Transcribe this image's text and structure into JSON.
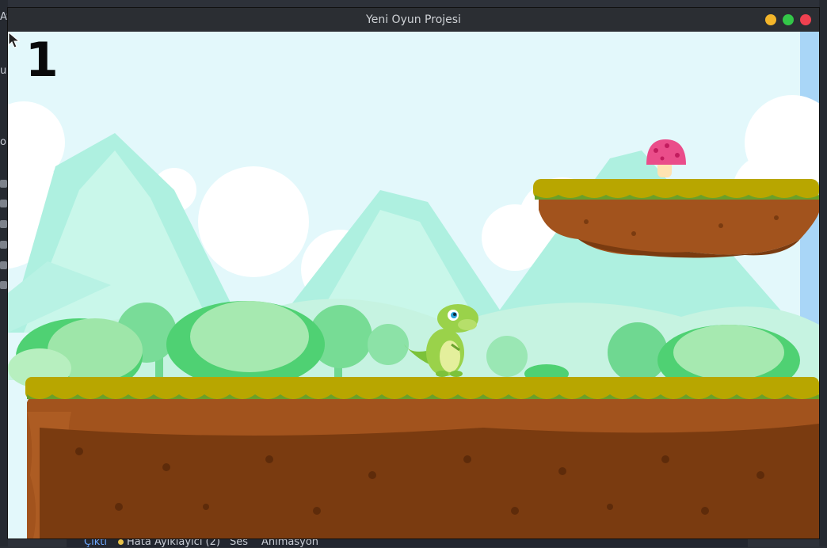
{
  "window": {
    "title": "Yeni Oyun Projesi",
    "controls": {
      "minimize_color": "#f3b52a",
      "maximize_color": "#33c748",
      "close_color": "#ef4150"
    }
  },
  "game": {
    "score": "1",
    "player": "green-dinosaur",
    "collectible": "pink-mushroom"
  },
  "editor": {
    "fragments": [
      "Ay",
      "u",
      "ou"
    ],
    "bottom_tabs": [
      {
        "label": "Çıktı",
        "active": true
      },
      {
        "label": "Hata Ayıklayıcı (2)",
        "active": false
      },
      {
        "label": "Ses",
        "active": false
      },
      {
        "label": "Animasyon",
        "active": false
      }
    ]
  },
  "colors": {
    "sky": "#e3f8fb",
    "grass": "#b8a600",
    "dirt": "#a2531d",
    "dirt_dark": "#7a3b10"
  }
}
